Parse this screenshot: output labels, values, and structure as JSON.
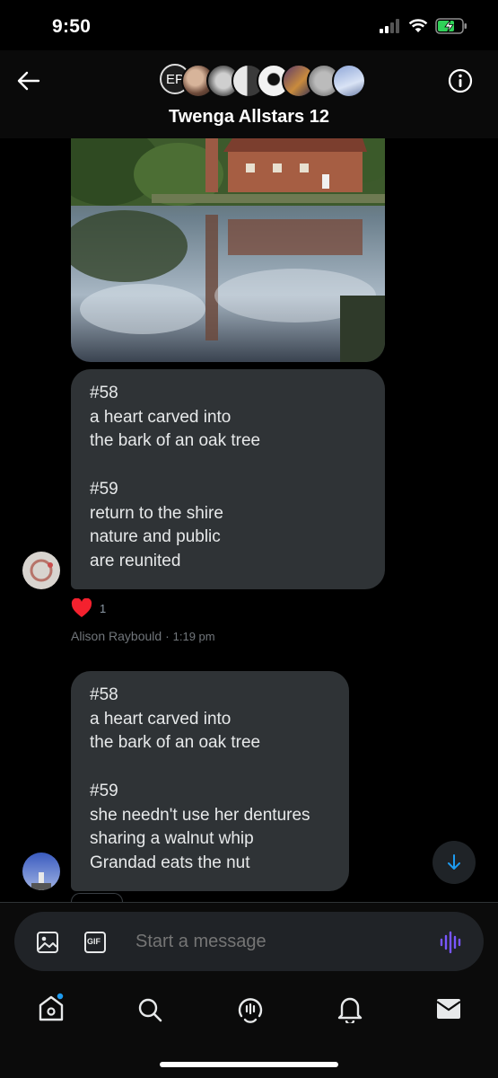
{
  "status_bar": {
    "time": "9:50"
  },
  "header": {
    "title": "Twenga Allstars 12",
    "first_avatar_initials": "EP"
  },
  "messages": [
    {
      "text": "#58\na heart carved into\nthe bark of an oak tree\n\n#59\nreturn to the shire\nnature and public\nare reunited",
      "reaction": {
        "emoji": "❤️",
        "count": "1"
      },
      "sender": "Alison Raybould",
      "time": "1:19 pm"
    },
    {
      "text": "#58\na heart carved into\nthe bark of an oak tree\n\n#59\nshe needn't use her dentures\nsharing a walnut whip\nGrandad eats the nut"
    }
  ],
  "composer": {
    "placeholder": "Start a message",
    "gif_label": "GIF"
  },
  "colors": {
    "accent": "#1d9bf0",
    "voice_accent": "#7856ff",
    "bubble": "#2f3336",
    "reaction_heart": "#f4212e"
  },
  "icons": [
    "back-arrow-icon",
    "info-icon",
    "image-icon",
    "gif-icon",
    "voice-icon",
    "arrow-down-icon",
    "home-icon",
    "search-icon",
    "spaces-icon",
    "bell-icon",
    "mail-icon"
  ]
}
